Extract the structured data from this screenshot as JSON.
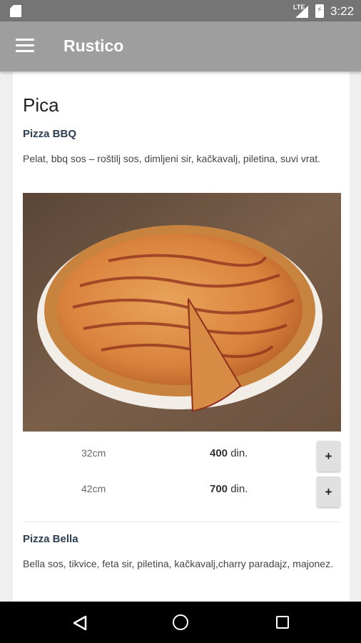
{
  "status_bar": {
    "network": "LTE",
    "time": "3:22",
    "icons": [
      "sd-card-icon",
      "signal-icon",
      "battery-charging-icon"
    ]
  },
  "app_bar": {
    "title": "Rustico",
    "menu_icon": "hamburger-menu-icon"
  },
  "menu": {
    "section_title": "Pica",
    "items": [
      {
        "name": "Pizza BBQ",
        "description": "Pelat, bbq sos – roštilj sos, dimljeni sir, kačkavalj, piletina, suvi vrat.",
        "image": "pizza-bbq-photo",
        "prices": [
          {
            "size": "32cm",
            "amount": "400",
            "currency": " din.",
            "add_label": "+"
          },
          {
            "size": "42cm",
            "amount": "700",
            "currency": " din.",
            "add_label": "+"
          }
        ]
      },
      {
        "name": "Pizza Bella",
        "description": "Bella sos, tikvice, feta sir, piletina, kačkavalj,charry paradajz, majonez."
      }
    ]
  },
  "nav_bar": {
    "icons": [
      "back-icon",
      "home-icon",
      "recent-apps-icon"
    ]
  },
  "colors": {
    "status_bar": "#757575",
    "app_bar": "#9e9e9e",
    "item_title": "#2c3e50",
    "flag_accent": "#e53935"
  }
}
